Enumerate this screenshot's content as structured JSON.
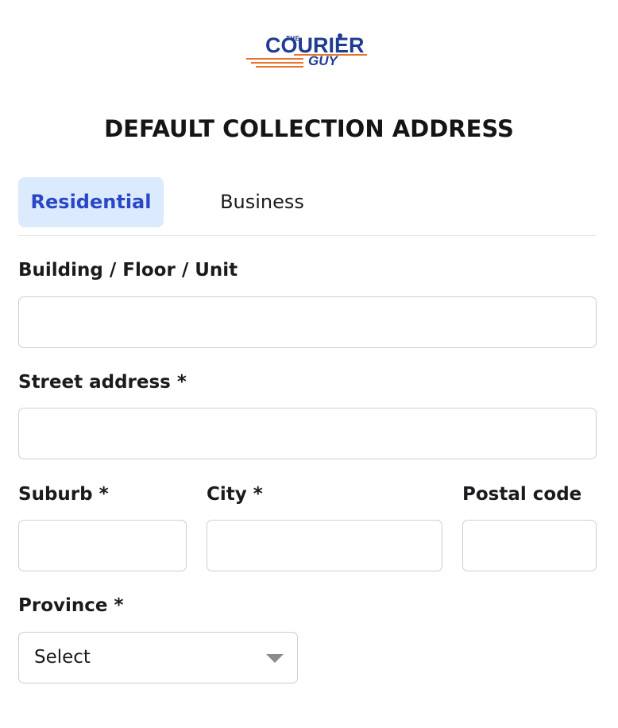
{
  "logo": {
    "small": "THE",
    "main": "COURIER",
    "sub": "GUY",
    "colors": {
      "navy": "#1f3c93",
      "orange": "#e8742c"
    }
  },
  "page_title": "DEFAULT COLLECTION ADDRESS",
  "tabs": [
    {
      "label": "Residential",
      "active": true
    },
    {
      "label": "Business",
      "active": false
    }
  ],
  "form": {
    "building": {
      "label": "Building / Floor / Unit",
      "value": ""
    },
    "street": {
      "label": "Street address *",
      "value": ""
    },
    "suburb": {
      "label": "Suburb *",
      "value": ""
    },
    "city": {
      "label": "City *",
      "value": ""
    },
    "postal": {
      "label": "Postal code",
      "value": ""
    },
    "province": {
      "label": "Province *",
      "value": "Select",
      "icon": "chevron-down-icon"
    }
  },
  "colors": {
    "accent": "#2947c7",
    "tab_active_bg": "#dbeafc",
    "border": "#cfcfd4"
  }
}
